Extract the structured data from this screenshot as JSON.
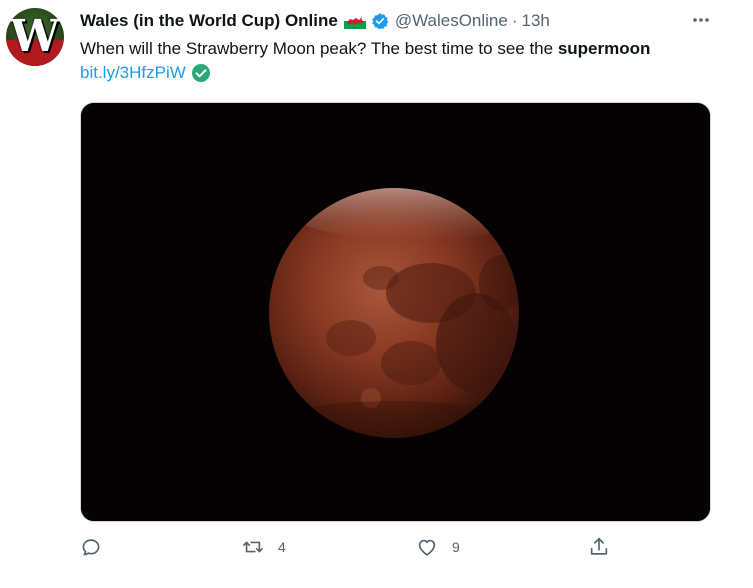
{
  "tweet": {
    "author_name": "Wales (in the World Cup) Online",
    "handle": "@WalesOnline",
    "separator": "·",
    "time": "13h",
    "avatar_letter": "W",
    "text_prefix": "When will the Strawberry Moon peak? The best time to see the ",
    "text_bold": "supermoon",
    "link": "bit.ly/3HfzPiW",
    "flag_icon": "wales-flag-icon",
    "verified_color": "#1d9bf0",
    "link_check_color": "#2aa87a",
    "media_icon": "blood-moon-photo"
  },
  "actions": {
    "reply_count": "",
    "retweet_count": "4",
    "like_count": "9",
    "share_count": ""
  },
  "colors": {
    "text": "#0f1419",
    "secondary": "#536471",
    "link": "#1d9bf0"
  }
}
